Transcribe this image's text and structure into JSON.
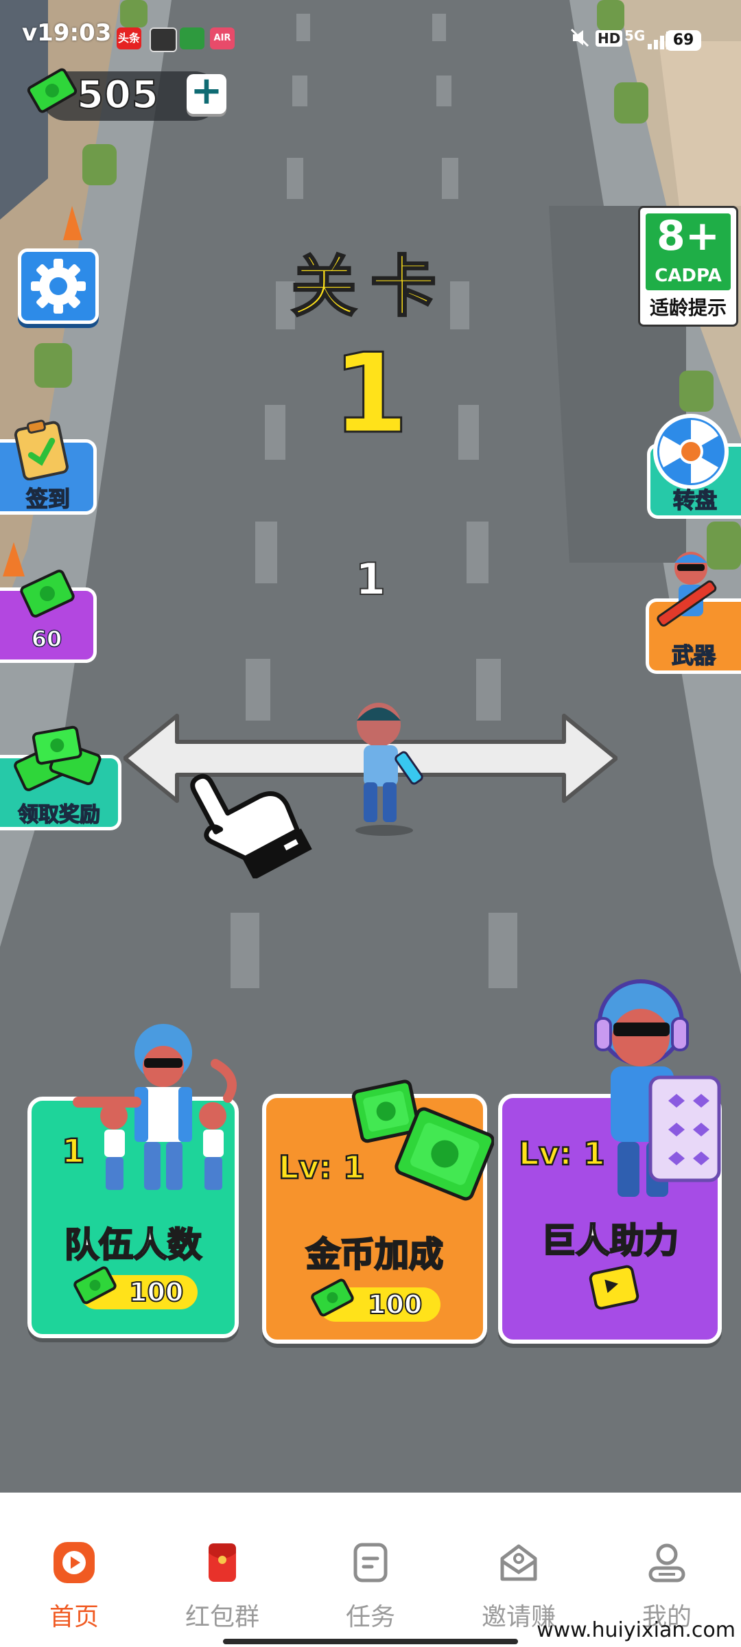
{
  "status_bar": {
    "time": "v19:03",
    "app_badges": [
      "头条",
      "AIR"
    ],
    "indicators": [
      "HD",
      "5G"
    ],
    "battery": "69"
  },
  "hud": {
    "money": "505",
    "plus_symbol": "+"
  },
  "side_buttons": {
    "settings_icon": "gear-icon",
    "checkin_label": "签到",
    "cash_amount": "60",
    "reward_label": "领取奖励",
    "age_rating_big": "8+",
    "age_rating_org": "CADPA",
    "age_rating_note": "适龄提示",
    "wheel_label": "转盘",
    "weapon_label": "武器"
  },
  "level": {
    "title": "关卡",
    "number": "1",
    "squad_count": "1"
  },
  "upgrades": [
    {
      "name": "队伍人数",
      "level": "1",
      "price": "100",
      "cost_type": "cash",
      "color": "#1ed49a"
    },
    {
      "name": "金币加成",
      "level": "Lv: 1",
      "price": "100",
      "cost_type": "cash",
      "color": "#f7932c"
    },
    {
      "name": "巨人助力",
      "level": "Lv: 1",
      "price": "",
      "cost_type": "video-ad",
      "color": "#a64ce6"
    }
  ],
  "nav": {
    "items": [
      {
        "label": "首页",
        "icon": "play-icon",
        "active": true
      },
      {
        "label": "红包群",
        "icon": "red-envelope-icon",
        "active": false
      },
      {
        "label": "任务",
        "icon": "task-icon",
        "active": false
      },
      {
        "label": "邀请赚",
        "icon": "invite-icon",
        "active": false
      },
      {
        "label": "我的",
        "icon": "profile-icon",
        "active": false
      }
    ],
    "active_color": "#f05a22"
  },
  "watermark": "www.huiyixian.com"
}
